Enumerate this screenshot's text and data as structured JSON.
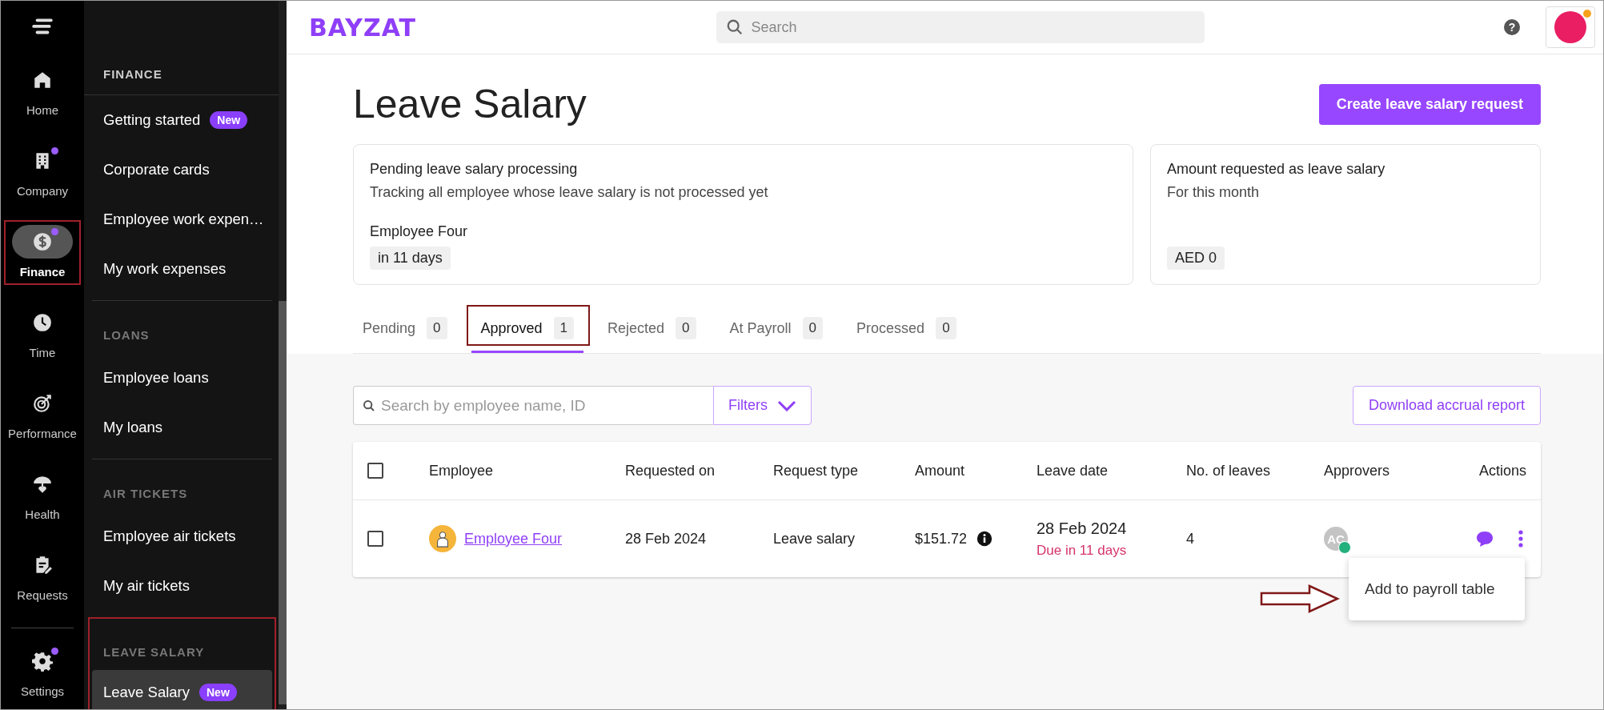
{
  "rail": {
    "items": [
      {
        "label": "Home",
        "selected": false,
        "dot": false,
        "annotated": false
      },
      {
        "label": "Company",
        "selected": false,
        "dot": true,
        "annotated": false
      },
      {
        "label": "Finance",
        "selected": true,
        "dot": true,
        "annotated": true
      },
      {
        "label": "Time",
        "selected": false,
        "dot": false,
        "annotated": false
      },
      {
        "label": "Performance",
        "selected": false,
        "dot": false,
        "annotated": false
      },
      {
        "label": "Health",
        "selected": false,
        "dot": false,
        "annotated": false
      },
      {
        "label": "Requests",
        "selected": false,
        "dot": false,
        "annotated": false
      }
    ],
    "settings": {
      "label": "Settings",
      "selected": false,
      "dot": true
    }
  },
  "submenu": {
    "sections": [
      {
        "title": "FINANCE",
        "annotated": false,
        "items": [
          {
            "label": "Getting started",
            "badge": "New",
            "selected": false
          },
          {
            "label": "Corporate cards",
            "selected": false
          },
          {
            "label": "Employee work expen…",
            "selected": false
          },
          {
            "label": "My work expenses",
            "selected": false
          }
        ]
      },
      {
        "title": "LOANS",
        "annotated": false,
        "items": [
          {
            "label": "Employee loans",
            "selected": false
          },
          {
            "label": "My loans",
            "selected": false
          }
        ]
      },
      {
        "title": "AIR TICKETS",
        "annotated": false,
        "items": [
          {
            "label": "Employee air tickets",
            "selected": false
          },
          {
            "label": "My air tickets",
            "selected": false
          }
        ]
      },
      {
        "title": "LEAVE SALARY",
        "annotated": true,
        "items": [
          {
            "label": "Leave Salary",
            "badge": "New",
            "selected": true
          }
        ]
      }
    ]
  },
  "header": {
    "logo": "BAYZAT",
    "search": {
      "placeholder": "Search"
    },
    "help": "?",
    "notification": true
  },
  "page": {
    "title": "Leave Salary",
    "create_button": "Create leave salary request"
  },
  "cards": [
    {
      "title": "Pending leave salary processing",
      "subtitle": "Tracking all employee whose leave salary is not processed yet",
      "name": "Employee Four",
      "chip": "in 11 days"
    },
    {
      "title": "Amount requested as leave salary",
      "subtitle": "For this month",
      "chip": "AED 0"
    }
  ],
  "tabs": [
    {
      "label": "Pending",
      "count": "0",
      "selected": false,
      "annotated": false
    },
    {
      "label": "Approved",
      "count": "1",
      "selected": true,
      "annotated": true
    },
    {
      "label": "Rejected",
      "count": "0",
      "selected": false,
      "annotated": false
    },
    {
      "label": "At Payroll",
      "count": "0",
      "selected": false,
      "annotated": false
    },
    {
      "label": "Processed",
      "count": "0",
      "selected": false,
      "annotated": false
    }
  ],
  "toolbar": {
    "search": {
      "placeholder": "Search by employee name, ID"
    },
    "filters": "Filters",
    "download": "Download accrual report"
  },
  "table": {
    "all_checked": false,
    "columns": [
      "Employee",
      "Requested on",
      "Request type",
      "Amount",
      "Leave date",
      "No. of leaves",
      "Approvers",
      "Actions"
    ],
    "rows": [
      {
        "checked": false,
        "employee": "Employee Four",
        "requested_on": "28 Feb 2024",
        "request_type": "Leave salary",
        "amount": "$151.72",
        "leave_date": "28 Feb 2024",
        "due": "Due in 11 days",
        "leaves": "4",
        "approver": "AC",
        "approved": true
      }
    ]
  },
  "menu": {
    "items": [
      "Add to payroll table"
    ]
  }
}
